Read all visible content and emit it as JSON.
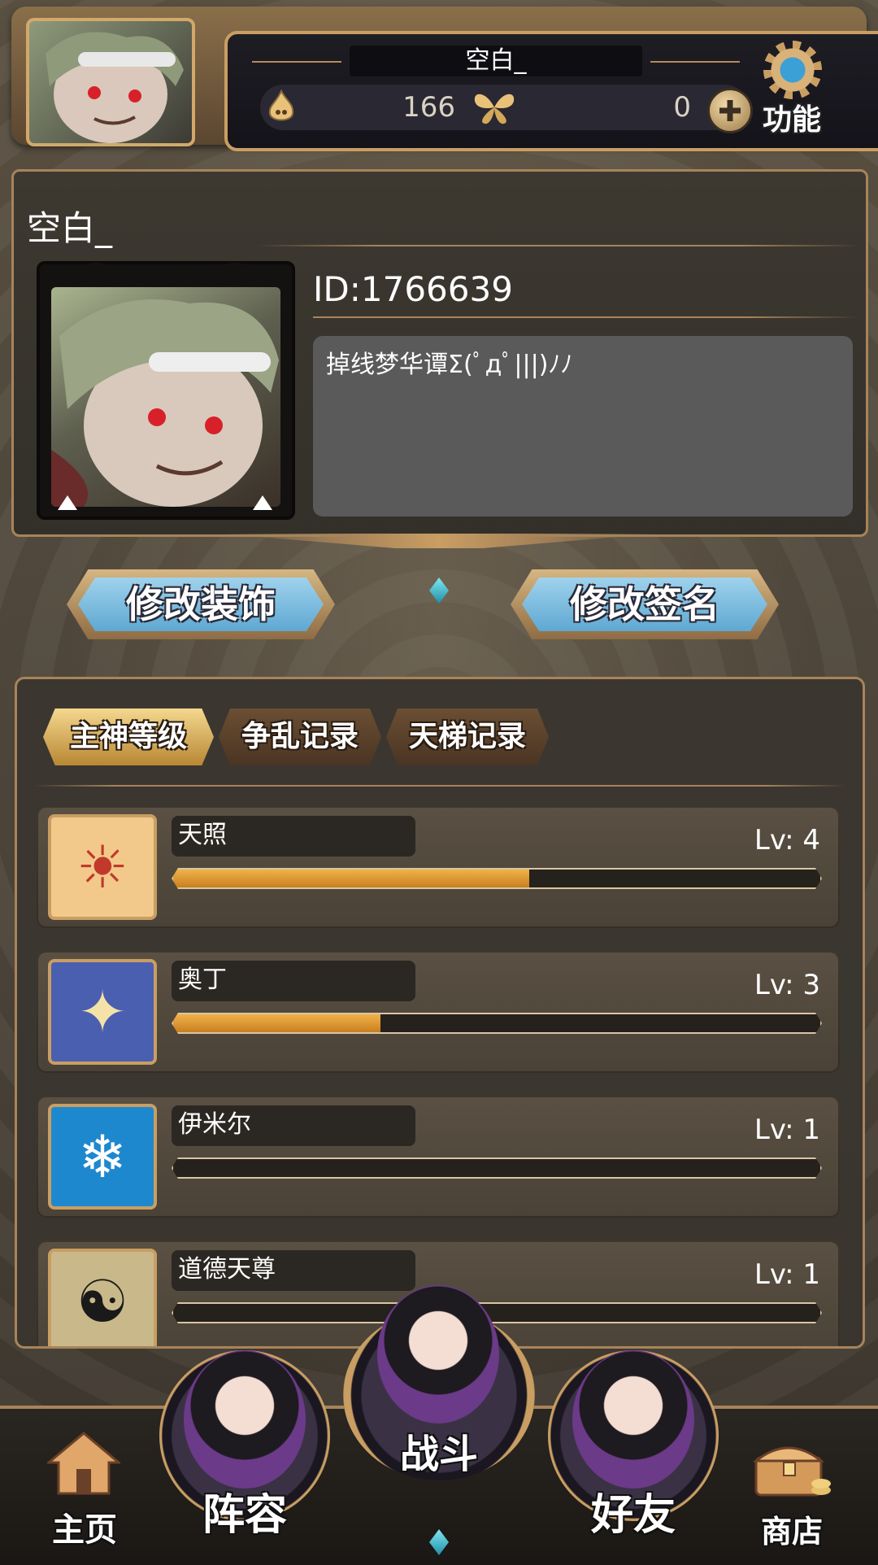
{
  "header": {
    "player_name": "空白_",
    "flame_value": "166",
    "butterfly_value": "0",
    "function_label": "功能"
  },
  "profile": {
    "name": "空白_",
    "id_text": "ID:1766639",
    "signature": "掉线梦华谭Σ(ﾟдﾟ|||)ﾉﾉ"
  },
  "actions": {
    "edit_decor": "修改装饰",
    "edit_signature": "修改签名"
  },
  "tabs": [
    "主神等级",
    "争乱记录",
    "天梯记录"
  ],
  "gods": [
    {
      "name": "天照",
      "level": "Lv: 4",
      "progress": 0.55,
      "icon_color": "#f2c98a",
      "icon_symbol": "☀"
    },
    {
      "name": "奥丁",
      "level": "Lv: 3",
      "progress": 0.32,
      "icon_color": "#4a5fb0",
      "icon_symbol": "✦"
    },
    {
      "name": "伊米尔",
      "level": "Lv: 1",
      "progress": 0.0,
      "icon_color": "#1e88cf",
      "icon_symbol": "❄"
    },
    {
      "name": "道德天尊",
      "level": "Lv: 1",
      "progress": 0.0,
      "icon_color": "#c9b98a",
      "icon_symbol": "☯"
    }
  ],
  "nav": {
    "home": "主页",
    "team": "阵容",
    "battle": "战斗",
    "friends": "好友",
    "shop": "商店"
  },
  "colors": {
    "accent_gold": "#c99e63",
    "button_blue": "#7fbde0",
    "progress_orange": "#f0b24a"
  }
}
